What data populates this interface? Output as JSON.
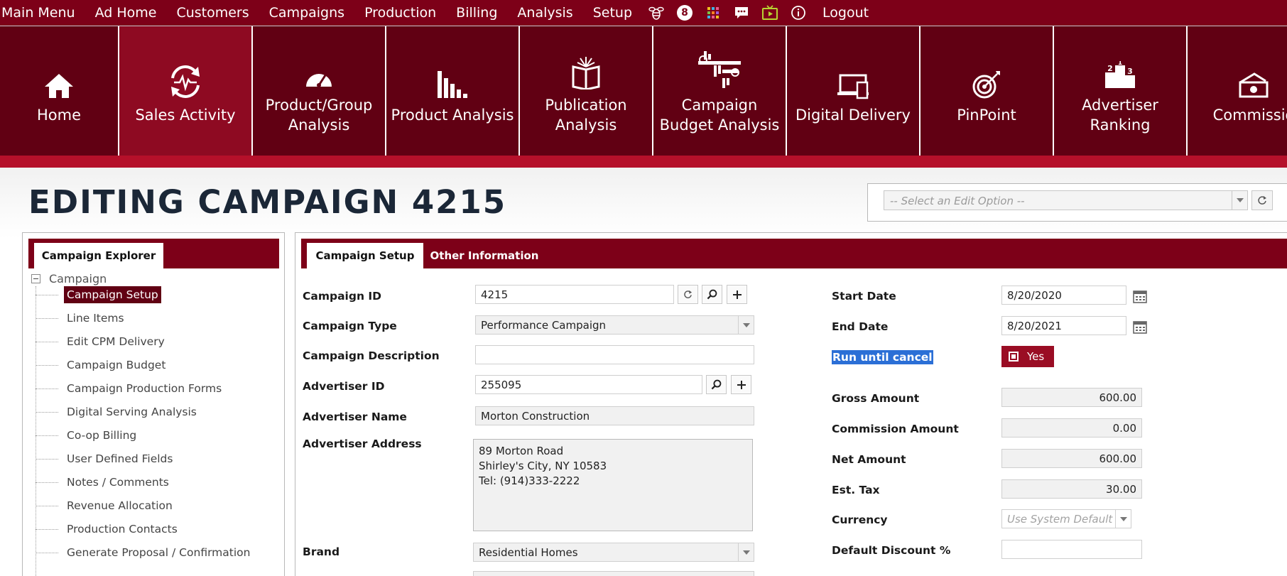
{
  "menu": {
    "items": [
      "Main Menu",
      "Ad Home",
      "Customers",
      "Campaigns",
      "Production",
      "Billing",
      "Analysis",
      "Setup"
    ],
    "badge_count": "8",
    "logout": "Logout"
  },
  "tiles": [
    {
      "label": "Home",
      "icon": "home-icon"
    },
    {
      "label": "Sales Activity",
      "icon": "sales-activity-icon",
      "active": true
    },
    {
      "label": "Product/Group Analysis",
      "icon": "gauge-icon"
    },
    {
      "label": "Product Analysis",
      "icon": "bar-chart-icon"
    },
    {
      "label": "Publication Analysis",
      "icon": "book-icon"
    },
    {
      "label": "Campaign Budget Analysis",
      "icon": "budget-icon"
    },
    {
      "label": "Digital Delivery",
      "icon": "devices-icon"
    },
    {
      "label": "PinPoint",
      "icon": "target-icon"
    },
    {
      "label": "Advertiser Ranking",
      "icon": "podium-icon"
    },
    {
      "label": "Commissio",
      "icon": "cash-icon"
    }
  ],
  "page": {
    "title": "EDITING CAMPAIGN 4215",
    "edit_option_placeholder": "-- Select an Edit Option --"
  },
  "explorer": {
    "tab": "Campaign Explorer",
    "root": "Campaign",
    "items": [
      "Campaign Setup",
      "Line Items",
      "Edit CPM Delivery",
      "Campaign Budget",
      "Campaign Production Forms",
      "Digital Serving Analysis",
      "Co-op Billing",
      "User Defined Fields",
      "Notes / Comments",
      "Revenue Allocation",
      "Production Contacts",
      "Generate Proposal / Confirmation"
    ]
  },
  "tabs": {
    "active": "Campaign Setup",
    "other": "Other Information"
  },
  "form": {
    "campaign_id_label": "Campaign ID",
    "campaign_id": "4215",
    "campaign_type_label": "Campaign Type",
    "campaign_type": "Performance Campaign",
    "description_label": "Campaign Description",
    "description": "",
    "advertiser_id_label": "Advertiser ID",
    "advertiser_id": "255095",
    "advertiser_name_label": "Advertiser Name",
    "advertiser_name": "Morton Construction",
    "advertiser_address_label": "Advertiser Address",
    "address_line1": "89 Morton Road",
    "address_line2": "Shirley's City, NY 10583",
    "address_line3": "Tel: (914)333-2222",
    "brand_label": "Brand",
    "brand": "Residential Homes",
    "start_date_label": "Start Date",
    "start_date": "8/20/2020",
    "end_date_label": "End Date",
    "end_date": "8/20/2021",
    "run_until_cancel_label": "Run until cancel",
    "run_until_cancel": "Yes",
    "gross_label": "Gross Amount",
    "gross": "600.00",
    "commission_label": "Commission Amount",
    "commission": "0.00",
    "net_label": "Net Amount",
    "net": "600.00",
    "tax_label": "Est. Tax",
    "tax": "30.00",
    "currency_label": "Currency",
    "currency_placeholder": "Use System Default",
    "discount_label": "Default Discount %",
    "discount": ""
  }
}
